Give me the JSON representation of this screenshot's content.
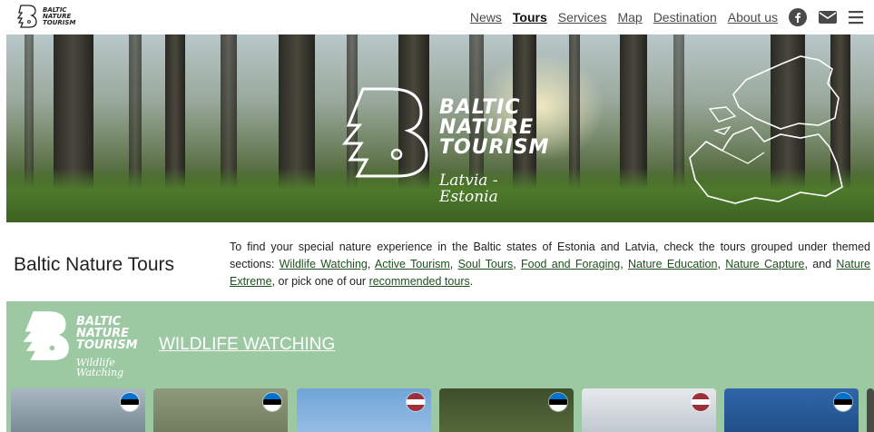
{
  "header": {
    "logo_lines": [
      "BALTIC",
      "NATURE",
      "TOURISM"
    ],
    "nav": [
      {
        "label": "News",
        "active": false
      },
      {
        "label": "Tours",
        "active": true
      },
      {
        "label": "Services",
        "active": false
      },
      {
        "label": "Map",
        "active": false
      },
      {
        "label": "Destination",
        "active": false
      },
      {
        "label": "About us",
        "active": false
      }
    ],
    "icons": [
      "facebook-icon",
      "mail-icon",
      "menu-icon"
    ]
  },
  "hero": {
    "title_lines": [
      "BALTIC",
      "NATURE",
      "TOURISM"
    ],
    "subtitle_lines": [
      "Latvia -",
      "Estonia"
    ]
  },
  "intro": {
    "title": "Baltic Nature Tours",
    "text_start": "To find your special nature experience in the Baltic states of Estonia and Latvia, check the tours grouped under themed sections: ",
    "links": [
      "Wildlife Watching",
      "Active Tourism",
      "Soul Tours",
      "Food and Foraging",
      "Nature Education",
      "Nature Capture",
      "Nature Extreme"
    ],
    "sep_comma": ", ",
    "sep_and": ", and ",
    "text_middle": ", or pick one of our ",
    "recommended_link": "recommended tours",
    "text_end": "."
  },
  "section": {
    "logo_lines": [
      "BALTIC",
      "NATURE",
      "TOURISM"
    ],
    "logo_sub_lines": [
      "Wildlife",
      "Watching"
    ],
    "heading": "WILDLIFE WATCHING",
    "cards": [
      {
        "flag": "estonia"
      },
      {
        "flag": "estonia"
      },
      {
        "flag": "latvia"
      },
      {
        "flag": "estonia"
      },
      {
        "flag": "latvia"
      },
      {
        "flag": "estonia"
      }
    ]
  },
  "colors": {
    "section_bg": "#9cc9a2",
    "link_dark": "#1f4f1f",
    "estonia_blue": "#0072ce",
    "latvia_red": "#9e3039"
  }
}
